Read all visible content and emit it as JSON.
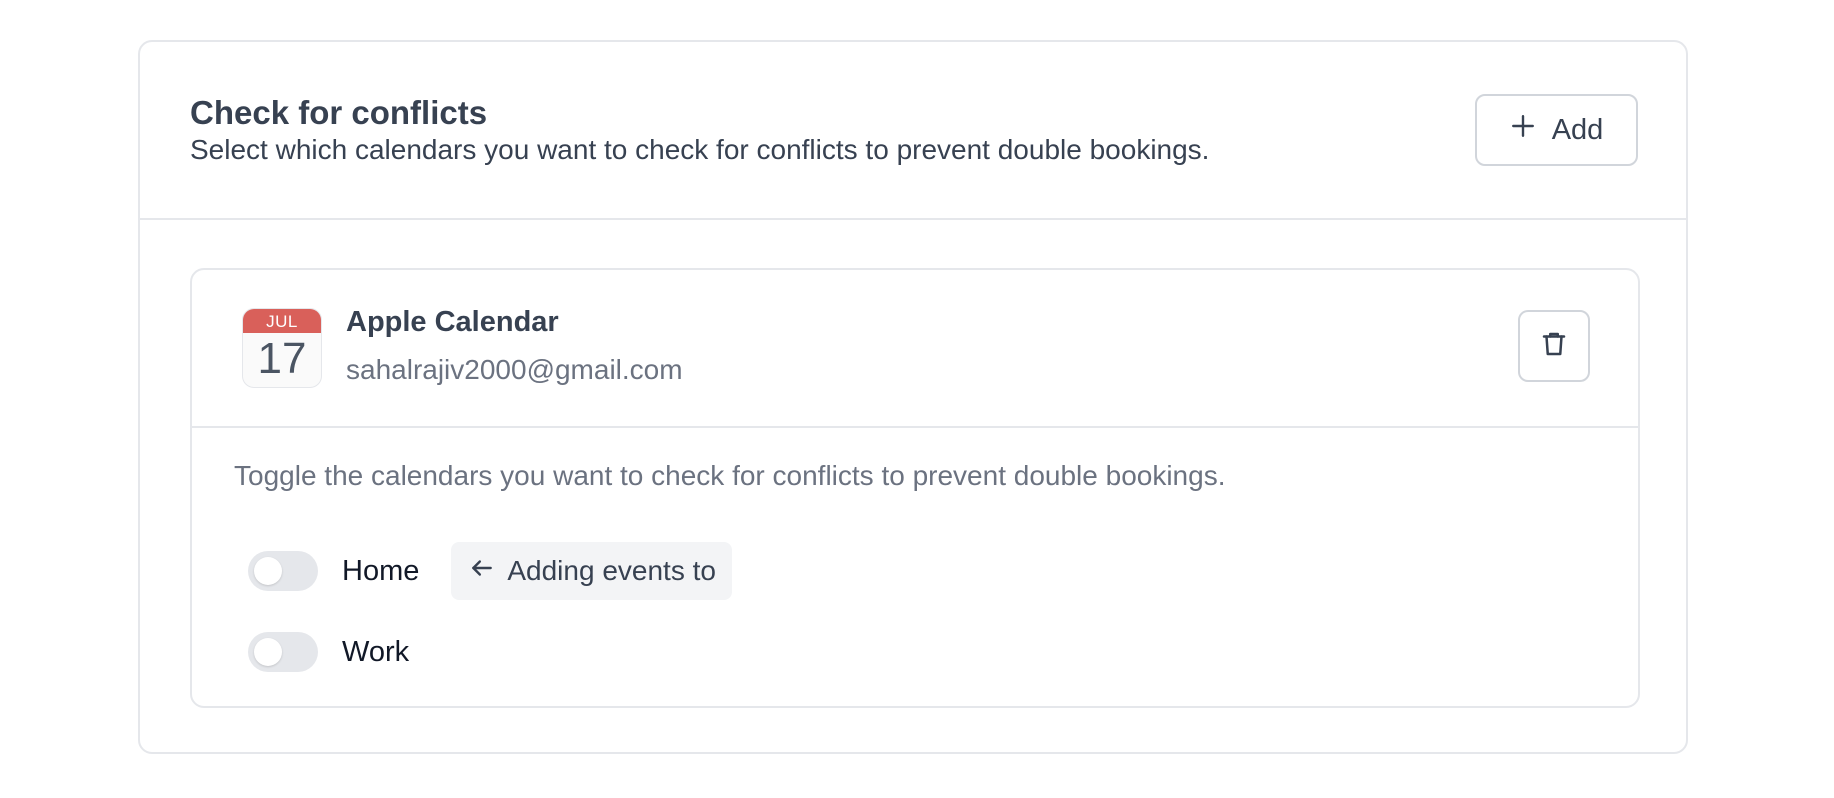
{
  "section": {
    "title": "Check for conflicts",
    "subtitle": "Select which calendars you want to check for conflicts to prevent double bookings.",
    "add_button": {
      "icon": "plus-icon",
      "label": "Add"
    }
  },
  "calendar": {
    "icon": {
      "name": "apple-calendar-icon",
      "month": "JUL",
      "day": "17",
      "accent_color": "#d9605a"
    },
    "name": "Apple Calendar",
    "email": "sahalrajiv2000@gmail.com",
    "delete_icon": "trash-icon",
    "helper_text": "Toggle the calendars you want to check for conflicts to prevent double bookings.",
    "items": [
      {
        "label": "Home",
        "enabled": false,
        "badge": {
          "icon": "arrow-left-icon",
          "label": "Adding events to"
        }
      },
      {
        "label": "Work",
        "enabled": false
      }
    ]
  }
}
